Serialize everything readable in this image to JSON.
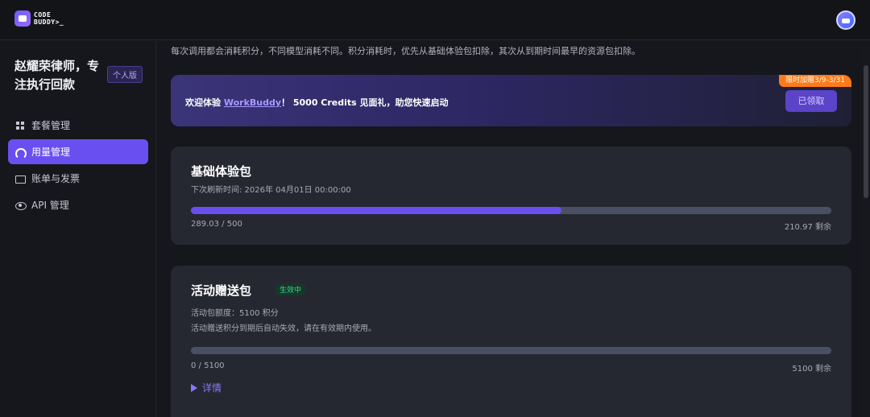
{
  "header": {
    "logo_line1": "CODE",
    "logo_line2": "BUDDY>_"
  },
  "sidebar": {
    "profile_name": "赵耀荣律师，专注执行回款",
    "plan_badge": "个人版",
    "items": [
      {
        "label": "套餐管理",
        "icon": "grid-icon"
      },
      {
        "label": "用量管理",
        "icon": "gauge-icon",
        "active": true
      },
      {
        "label": "账单与发票",
        "icon": "bill-icon"
      },
      {
        "label": "API 管理",
        "icon": "eye-icon"
      }
    ]
  },
  "main": {
    "description": "每次调用都会消耗积分，不同模型消耗不同。积分消耗时，优先从基础体验包扣除，其次从到期时间最早的资源包扣除。",
    "promo": {
      "prefix": "欢迎体验 ",
      "link": "WorkBuddy",
      "suffix": "！ 5000 Credits 见面礼，助您快速启动",
      "tag": "限时加赠3/9-3/31",
      "button": "已领取"
    },
    "basic_pack": {
      "title": "基础体验包",
      "refresh_time": "下次刷新时间: 2026年 04月01日 00:00:00",
      "used_label": "289.03 / 500",
      "remaining_label": "210.97 剩余",
      "used": 289.03,
      "total": 500
    },
    "gift_pack": {
      "title": "活动赠送包",
      "status": "生效中",
      "quota": "活动包额度：5100 积分",
      "note": "活动赠送积分到期后自动失效，请在有效期内使用。",
      "used_label": "0 / 5100",
      "remaining_label": "5100 剩余",
      "used": 0,
      "total": 5100,
      "details": "详情"
    }
  },
  "colors": {
    "accent": "#6a4ff0",
    "orange_tag": "#ff7a18",
    "status_green": "#3cd48a"
  }
}
